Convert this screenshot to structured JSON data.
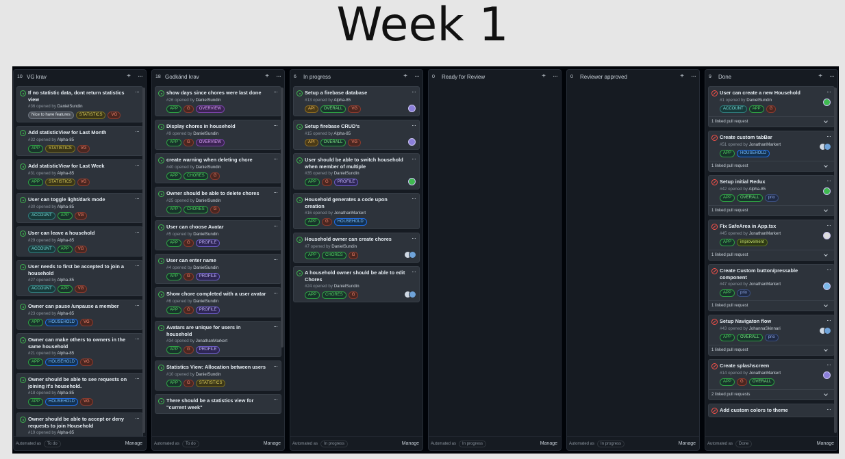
{
  "title": "Week 1",
  "label_colors": {
    "APP": {
      "bg": "#17332a",
      "fg": "#56d364",
      "bd": "#2ea043"
    },
    "G": {
      "bg": "#4a2620",
      "fg": "#ff8a72",
      "bd": "#8a3a2e"
    },
    "VG": {
      "bg": "#4a2620",
      "fg": "#ff8a72",
      "bd": "#8a3a2e"
    },
    "OVERVIEW": {
      "bg": "#3b2352",
      "fg": "#e2a6ff",
      "bd": "#7a43a8"
    },
    "STATISTICS": {
      "bg": "#3a3517",
      "fg": "#e3d560",
      "bd": "#7a6e22"
    },
    "Nice to have features": {
      "bg": "#4a4f57",
      "fg": "#e6edf3",
      "bd": "#6e7681"
    },
    "ACCOUNT": {
      "bg": "#173a3a",
      "fg": "#7ee0e0",
      "bd": "#2e7a7a"
    },
    "HOUSEHOLD": {
      "bg": "#14314f",
      "fg": "#79c0ff",
      "bd": "#1f6feb"
    },
    "CHORES": {
      "bg": "#17332a",
      "fg": "#56d364",
      "bd": "#2ea043"
    },
    "PROFILE": {
      "bg": "#2e2654",
      "fg": "#c4b6ff",
      "bd": "#6a5bc4"
    },
    "API": {
      "bg": "#4a3a17",
      "fg": "#f0c060",
      "bd": "#8a6a22"
    },
    "OVERALL": {
      "bg": "#17332a",
      "fg": "#7ee787",
      "bd": "#2ea043"
    },
    "prio": {
      "bg": "#1f2a44",
      "fg": "#8fa8e8",
      "bd": "#3b4f80"
    },
    "improvement": {
      "bg": "#2e3a14",
      "fg": "#c8e070",
      "bd": "#5a7020"
    }
  },
  "columns": [
    {
      "count": "10",
      "name": "VG krav",
      "automated": "To do",
      "manage": "Manage",
      "auto_label": "Automated as",
      "cards": [
        {
          "status": "open",
          "title": "If no statistic data, dont return statistics view",
          "num": "#36",
          "opened_by": "opened by",
          "author": "DanielSundin",
          "labels": [
            "Nice to have features",
            "STATISTICS",
            "VG"
          ]
        },
        {
          "status": "open",
          "title": "Add statisticView for Last Month",
          "num": "#32",
          "opened_by": "opened by",
          "author": "Alpha-85",
          "labels": [
            "APP",
            "STATISTICS",
            "VG"
          ]
        },
        {
          "status": "open",
          "title": "Add statisticView for Last Week",
          "num": "#31",
          "opened_by": "opened by",
          "author": "Alpha-85",
          "labels": [
            "APP",
            "STATISTICS",
            "VG"
          ]
        },
        {
          "status": "open",
          "title": "User can toggle light/dark mode",
          "num": "#30",
          "opened_by": "opened by",
          "author": "Alpha-85",
          "labels": [
            "ACCOUNT",
            "APP",
            "VG"
          ]
        },
        {
          "status": "open",
          "title": "User can leave a household",
          "num": "#29",
          "opened_by": "opened by",
          "author": "Alpha-85",
          "labels": [
            "ACCOUNT",
            "APP",
            "VG"
          ]
        },
        {
          "status": "open",
          "title": "User needs to first be accepted to join a household",
          "num": "#27",
          "opened_by": "opened by",
          "author": "Alpha-85",
          "labels": [
            "ACCOUNT",
            "APP",
            "VG"
          ]
        },
        {
          "status": "open",
          "title": "Owner can pause /unpause a member",
          "num": "#23",
          "opened_by": "opened by",
          "author": "Alpha-85",
          "labels": [
            "APP",
            "HOUSEHOLD",
            "VG"
          ]
        },
        {
          "status": "open",
          "title": "Owner can make others to owners in the same household",
          "num": "#21",
          "opened_by": "opened by",
          "author": "Alpha-85",
          "labels": [
            "APP",
            "HOUSEHOLD",
            "VG"
          ]
        },
        {
          "status": "open",
          "title": "Owner should be able to see requests on joining it's household.",
          "num": "#18",
          "opened_by": "opened by",
          "author": "Alpha-85",
          "labels": [
            "APP",
            "HOUSEHOLD",
            "VG"
          ]
        },
        {
          "status": "open",
          "title": "Owner should be able to accept or deny requests to join Household",
          "num": "#19",
          "opened_by": "opened by",
          "author": "Alpha-85",
          "labels": []
        }
      ]
    },
    {
      "count": "18",
      "name": "Godkänd krav",
      "automated": "To do",
      "manage": "Manage",
      "auto_label": "Automated as",
      "cards": [
        {
          "status": "open",
          "title": "show days since chores were last done",
          "num": "#26",
          "opened_by": "opened by",
          "author": "DanielSundin",
          "labels": [
            "APP",
            "G",
            "OVERVIEW"
          ]
        },
        {
          "status": "open",
          "title": "Display chores in household",
          "num": "#9",
          "opened_by": "opened by",
          "author": "DanielSundin",
          "labels": [
            "APP",
            "G",
            "OVERVIEW"
          ]
        },
        {
          "status": "open",
          "title": "create warning when deleting chore",
          "num": "#40",
          "opened_by": "opened by",
          "author": "DanielSundin",
          "labels": [
            "APP",
            "CHORES",
            "G"
          ]
        },
        {
          "status": "open",
          "title": "Owner should be able to delete chores",
          "num": "#25",
          "opened_by": "opened by",
          "author": "DanielSundin",
          "labels": [
            "APP",
            "CHORES",
            "G"
          ]
        },
        {
          "status": "open",
          "title": "User can choose Avatar",
          "num": "#5",
          "opened_by": "opened by",
          "author": "DanielSundin",
          "labels": [
            "APP",
            "G",
            "PROFILE"
          ]
        },
        {
          "status": "open",
          "title": "User can enter name",
          "num": "#4",
          "opened_by": "opened by",
          "author": "DanielSundin",
          "labels": [
            "APP",
            "G",
            "PROFILE"
          ]
        },
        {
          "status": "open",
          "title": "Show chore completed with a user avatar",
          "num": "#6",
          "opened_by": "opened by",
          "author": "DanielSundin",
          "labels": [
            "APP",
            "G",
            "PROFILE"
          ]
        },
        {
          "status": "open",
          "title": "Avatars are unique for users in household",
          "num": "#34",
          "opened_by": "opened by",
          "author": "JonathanMarkert",
          "labels": [
            "APP",
            "G",
            "PROFILE"
          ]
        },
        {
          "status": "open",
          "title": "Statistics View: Allocation between users",
          "num": "#10",
          "opened_by": "opened by",
          "author": "DanielSundin",
          "labels": [
            "APP",
            "G",
            "STATISTICS"
          ]
        },
        {
          "status": "open",
          "title": "There should be a statistics view for \"current week\"",
          "num": "",
          "opened_by": "",
          "author": "",
          "labels": []
        }
      ]
    },
    {
      "count": "6",
      "name": "In progress",
      "automated": "In progress",
      "manage": "Manage",
      "auto_label": "Automated as",
      "cards": [
        {
          "status": "open",
          "title": "Setup a firebase database",
          "num": "#13",
          "opened_by": "opened by",
          "author": "Alpha-85",
          "labels": [
            "API",
            "OVERALL",
            "VG"
          ],
          "avatar": "single"
        },
        {
          "status": "open",
          "title": "Setup firebase CRUD's",
          "num": "#15",
          "opened_by": "opened by",
          "author": "Alpha-85",
          "labels": [
            "API",
            "OVERALL",
            "VG"
          ],
          "avatar": "single"
        },
        {
          "status": "open",
          "title": "User should be able to switch household when member of multiple",
          "num": "#35",
          "opened_by": "opened by",
          "author": "DanielSundin",
          "labels": [
            "APP",
            "G",
            "PROFILE"
          ],
          "avatar": "green"
        },
        {
          "status": "open",
          "title": "Household generates a code upon creation",
          "num": "#16",
          "opened_by": "opened by",
          "author": "JonathanMarkert",
          "labels": [
            "APP",
            "G",
            "HOUSEHOLD"
          ]
        },
        {
          "status": "open",
          "title": "Household owner can create chores",
          "num": "#7",
          "opened_by": "opened by",
          "author": "DanielSundin",
          "labels": [
            "APP",
            "CHORES",
            "G"
          ],
          "avatar": "pair"
        },
        {
          "status": "open",
          "title": "A household owner should be able to edit Chores",
          "num": "#24",
          "opened_by": "opened by",
          "author": "DanielSundin",
          "labels": [
            "APP",
            "CHORES",
            "G"
          ],
          "avatar": "pair"
        }
      ]
    },
    {
      "count": "0",
      "name": "Ready for Review",
      "automated": "In progress",
      "manage": "Manage",
      "auto_label": "Automated as",
      "cards": []
    },
    {
      "count": "0",
      "name": "Reviewer approved",
      "automated": "In progress",
      "manage": "Manage",
      "auto_label": "Automated as",
      "cards": []
    },
    {
      "count": "9",
      "name": "Done",
      "automated": "Done",
      "manage": "Manage",
      "auto_label": "Automated as",
      "cards": [
        {
          "status": "closed",
          "title": "User can create a new Household",
          "num": "#1",
          "opened_by": "opened by",
          "author": "DanielSundin",
          "labels": [
            "ACCOUNT",
            "APP",
            "G"
          ],
          "avatar": "green",
          "pr": "1 linked pull request"
        },
        {
          "status": "closed",
          "title": "Create custom tabBar",
          "num": "#51",
          "opened_by": "opened by",
          "author": "JonathanMarkert",
          "labels": [
            "APP",
            "HOUSEHOLD"
          ],
          "avatar": "pair",
          "pr": "1 linked pull request"
        },
        {
          "status": "closed",
          "title": "Setup initial Redux",
          "num": "#42",
          "opened_by": "opened by",
          "author": "Alpha-85",
          "labels": [
            "APP",
            "OVERALL",
            "prio"
          ],
          "avatar": "green",
          "pr": "1 linked pull request"
        },
        {
          "status": "closed",
          "title": "Fix SafeArea in App.tsx",
          "num": "#45",
          "opened_by": "opened by",
          "author": "JonathanMarkert",
          "labels": [
            "APP",
            "improvement"
          ],
          "avatar": "white",
          "pr": "1 linked pull request"
        },
        {
          "status": "closed",
          "title": "Create Custom button/pressable component",
          "num": "#47",
          "opened_by": "opened by",
          "author": "JonathanMarkert",
          "labels": [
            "APP",
            "prio"
          ],
          "avatar": "blue",
          "pr": "1 linked pull request"
        },
        {
          "status": "closed",
          "title": "Setup Navigaton flow",
          "num": "#43",
          "opened_by": "opened by",
          "author": "JohannaSkinnari",
          "labels": [
            "APP",
            "OVERALL",
            "prio"
          ],
          "avatar": "pair",
          "pr": "1 linked pull request"
        },
        {
          "status": "closed",
          "title": "Create splashscreen",
          "num": "#14",
          "opened_by": "opened by",
          "author": "JonathanMarkert",
          "labels": [
            "APP",
            "G",
            "OVERALL"
          ],
          "avatar": "single",
          "pr": "2 linked pull requests"
        },
        {
          "status": "closed",
          "title": "Add custom colors to theme",
          "num": "",
          "opened_by": "",
          "author": "",
          "labels": []
        }
      ]
    }
  ]
}
